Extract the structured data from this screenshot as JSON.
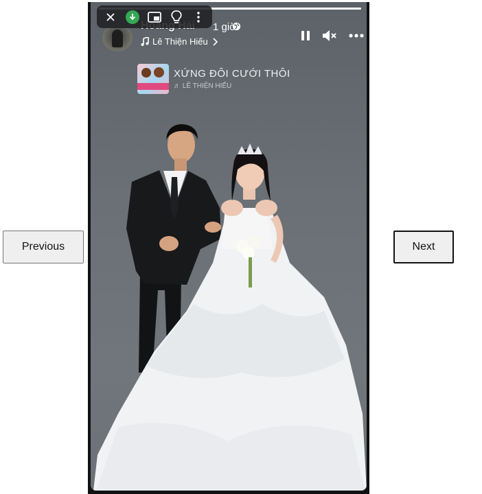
{
  "nav": {
    "previous": "Previous",
    "next": "Next"
  },
  "story": {
    "user_name": "Hoàng Hải",
    "time_ago": "1 giờ",
    "music_artist": "Lê Thiện Hiếu",
    "progress": 1.0,
    "sticker": {
      "song_title": "XỨNG ĐÔI CƯỚI THÔI",
      "artist": "♬ LÊ THIỆN HIẾU"
    }
  },
  "icons": {
    "close": "close-icon",
    "download": "download-icon",
    "picture_in_picture": "picture-in-picture-icon",
    "lightbulb": "lightbulb-icon",
    "more": "more-vertical-icon",
    "globe": "globe-icon",
    "music_note": "music-note-icon",
    "chevron": "chevron-right-icon",
    "pause": "pause-icon",
    "mute": "volume-mute-icon",
    "options": "more-horizontal-icon"
  },
  "colors": {
    "download_green": "#34a853",
    "backdrop": "#6a7075"
  }
}
